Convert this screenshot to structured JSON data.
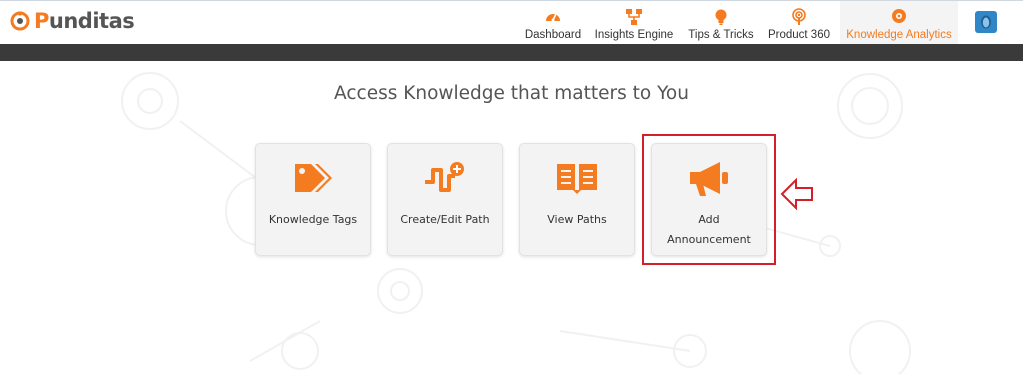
{
  "app": {
    "brand": {
      "prefix": "P",
      "rest": "unditas"
    },
    "colors": {
      "accent": "#f47b20",
      "highlight": "#d32028",
      "darkbar": "#3a3a3a"
    }
  },
  "nav": [
    {
      "label": "Dashboard",
      "icon": "speedometer-icon"
    },
    {
      "label": "Insights Engine",
      "icon": "hierarchy-icon"
    },
    {
      "label": "Tips & Tricks",
      "icon": "lightbulb-icon"
    },
    {
      "label": "Product 360",
      "icon": "podcast-icon"
    },
    {
      "label": "Knowledge Analytics",
      "icon": "brain-icon",
      "active": true
    }
  ],
  "main": {
    "heading": "Access Knowledge that matters to You",
    "tiles": [
      {
        "label": "Knowledge Tags",
        "icon": "tags-icon"
      },
      {
        "label": "Create/Edit Path",
        "icon": "path-add-icon"
      },
      {
        "label": "View Paths",
        "icon": "book-open-icon"
      },
      {
        "label": "Add\nAnnouncement",
        "icon": "megaphone-icon"
      }
    ]
  }
}
